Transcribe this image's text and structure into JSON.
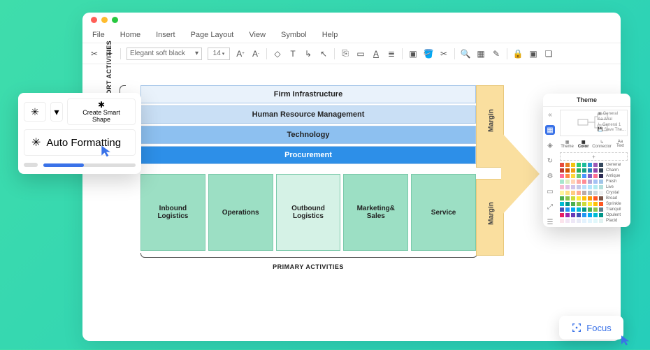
{
  "menus": {
    "file": "File",
    "home": "Home",
    "insert": "Insert",
    "page_layout": "Page Layout",
    "view": "View",
    "symbol": "Symbol",
    "help": "Help"
  },
  "toolbar": {
    "font": "Elegant soft black",
    "size": "14"
  },
  "popup": {
    "create_smart_shape": "Create Smart\nShape",
    "auto_formatting": "Auto Formatting"
  },
  "diagram": {
    "support_label": "SUPPORT\nACTIVITIES",
    "primary_label": "PRIMARY ACTIVITIES",
    "margin": "Margin",
    "bars": [
      "Firm Infrastructure",
      "Human Resource Management",
      "Technology",
      "Procurement"
    ],
    "primary": [
      "Inbound Logistics",
      "Operations",
      "Outbound Logistics",
      "Marketing& Sales",
      "Service"
    ]
  },
  "theme": {
    "title": "Theme",
    "side_items": [
      "General",
      "Arial",
      "General 1",
      "Save The..."
    ],
    "tabs": {
      "theme": "Theme",
      "color": "Color",
      "connector": "Connector",
      "text": "Text"
    },
    "swatches": [
      "General",
      "Charm",
      "Antique",
      "Fresh",
      "Live",
      "Crystal",
      "Broad",
      "Sprinkle",
      "Tranquil",
      "Opulent",
      "Placid"
    ]
  },
  "focus": {
    "label": "Focus"
  },
  "colors": {
    "rows": [
      [
        "#E74C3C",
        "#E67E22",
        "#F1C40F",
        "#2ECC71",
        "#1ABC9C",
        "#3498DB",
        "#9B59B6",
        "#34495E"
      ],
      [
        "#C0392B",
        "#D35400",
        "#F39C12",
        "#27AE60",
        "#16A085",
        "#2980B9",
        "#8E44AD",
        "#2C3E50"
      ],
      [
        "#FF6B9D",
        "#FF8C42",
        "#FFD93D",
        "#6BCB77",
        "#4D96FF",
        "#845EC2",
        "#FF6F91",
        "#2C2C54"
      ],
      [
        "#A8E6CF",
        "#DCEDC1",
        "#FFD3B6",
        "#FFAAA5",
        "#FF8B94",
        "#B4A7D6",
        "#A4C2F4",
        "#9FC5E8"
      ],
      [
        "#F8BBD0",
        "#E1BEE7",
        "#D1C4E9",
        "#C5CAE9",
        "#BBDEFB",
        "#B3E5FC",
        "#B2EBF2",
        "#B2DFDB"
      ],
      [
        "#FFF59D",
        "#FFE082",
        "#FFCC80",
        "#FFAB91",
        "#BCAAA4",
        "#B0BEC5",
        "#CFD8DC",
        "#ECEFF1"
      ],
      [
        "#4CAF50",
        "#8BC34A",
        "#CDDC39",
        "#FFEB3B",
        "#FFC107",
        "#FF9800",
        "#FF5722",
        "#795548"
      ],
      [
        "#00BCD4",
        "#009688",
        "#4CAF50",
        "#8BC34A",
        "#CDDC39",
        "#FFEB3B",
        "#FFC107",
        "#FF5722"
      ],
      [
        "#3F51B5",
        "#2196F3",
        "#03A9F4",
        "#00BCD4",
        "#009688",
        "#4CAF50",
        "#8BC34A",
        "#607D8B"
      ],
      [
        "#E91E63",
        "#9C27B0",
        "#673AB7",
        "#3F51B5",
        "#2196F3",
        "#03A9F4",
        "#00BCD4",
        "#009688"
      ],
      [
        "#FCE4EC",
        "#F3E5F5",
        "#EDE7F6",
        "#E8EAF6",
        "#E3F2FD",
        "#E1F5FE",
        "#E0F7FA",
        "#E0F2F1"
      ]
    ]
  }
}
